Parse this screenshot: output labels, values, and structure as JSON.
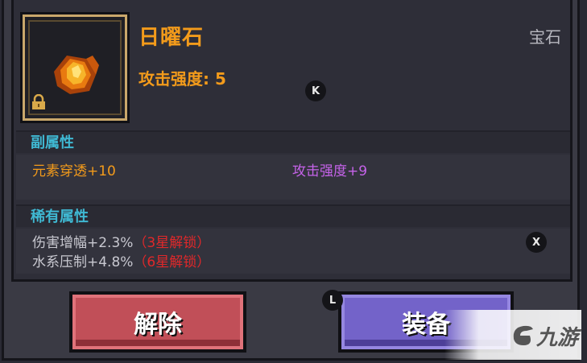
{
  "item": {
    "name": "日曜石",
    "type": "宝石",
    "main_stat": "攻击强度: 5"
  },
  "hints": {
    "k": "K",
    "x": "X",
    "l": "L"
  },
  "sub_attributes": {
    "title": "副属性",
    "left": "元素穿透+10",
    "right": "攻击强度+9"
  },
  "rare_attributes": {
    "title": "稀有属性",
    "rows": [
      {
        "text": "伤害增幅+2.3%",
        "lock": "（3星解锁）"
      },
      {
        "text": "水系压制+4.8%",
        "lock": "（6星解锁）"
      }
    ]
  },
  "buttons": {
    "remove": "解除",
    "equip": "装备"
  },
  "watermark": {
    "text": "九游"
  },
  "colors": {
    "item_name": "#f39b1b",
    "section_title": "#3fb8d2",
    "purple_stat": "#c663ea",
    "lock_red": "#e0282a",
    "remove_button": "#c14f58",
    "equip_button": "#7363c9"
  }
}
